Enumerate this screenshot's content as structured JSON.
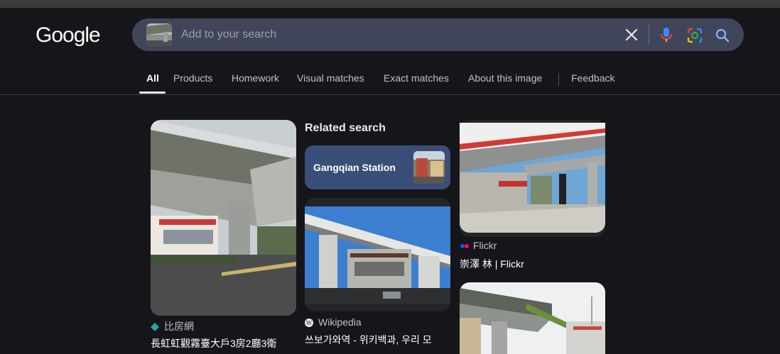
{
  "header": {
    "logo_text": "Google",
    "search": {
      "placeholder": "Add to your search"
    }
  },
  "tabs": [
    {
      "label": "All",
      "active": true
    },
    {
      "label": "Products"
    },
    {
      "label": "Homework"
    },
    {
      "label": "Visual matches"
    },
    {
      "label": "Exact matches"
    },
    {
      "label": "About this image"
    },
    {
      "label": "Feedback"
    }
  ],
  "related": {
    "heading": "Related search",
    "item": {
      "label": "Gangqian Station"
    }
  },
  "results": {
    "col1": {
      "source": "比房網",
      "title": "長虹虹觀霧臺大戶3房2廳3衛"
    },
    "col2": {
      "source": "Wikipedia",
      "title": "쓰보가와역 - 위키백과, 우리 모"
    },
    "col3": {
      "source": "Flickr",
      "title": "崇澤 林 | Flickr"
    }
  },
  "colors": {
    "background": "#16161a",
    "searchbar": "#40455a",
    "related_card": "#3a4f78"
  }
}
